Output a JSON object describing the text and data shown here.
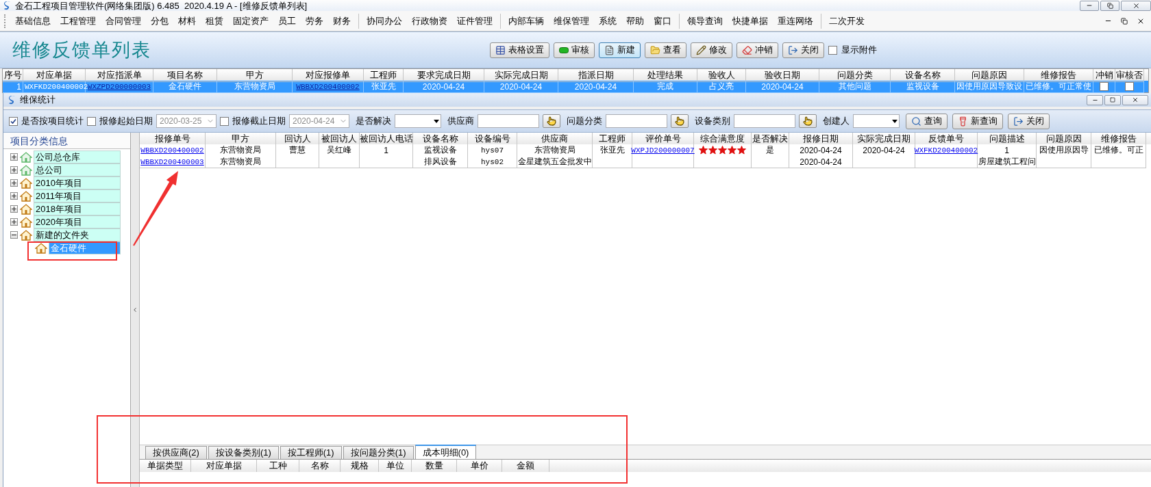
{
  "window": {
    "title": "金石工程项目管理软件(网络集团版) 6.485  2020.4.19 A - [维修反馈单列表]"
  },
  "menu_groups": [
    [
      "基础信息",
      "工程管理",
      "合同管理",
      "分包",
      "材料",
      "租赁",
      "固定资产",
      "员工",
      "劳务",
      "财务"
    ],
    [
      "协同办公",
      "行政物资",
      "证件管理"
    ],
    [
      "内部车辆",
      "维保管理",
      "系统",
      "帮助",
      "窗口"
    ],
    [
      "领导查询",
      "快捷单据",
      "重连网络"
    ],
    [
      "二次开发"
    ]
  ],
  "list_view": {
    "title": "维修反馈单列表",
    "toolbar": [
      {
        "label": "表格设置",
        "focused": false
      },
      {
        "label": "审核",
        "focused": false
      },
      {
        "label": "新建",
        "focused": true
      },
      {
        "label": "查看",
        "focused": false
      },
      {
        "label": "修改",
        "focused": false
      },
      {
        "label": "冲销",
        "focused": false
      },
      {
        "label": "关闭",
        "focused": false
      }
    ],
    "show_attachments": {
      "label": "显示附件",
      "checked": false
    },
    "table": {
      "columns": [
        {
          "label": "序号",
          "kind": "number"
        },
        {
          "label": "对应单据",
          "kind": "code"
        },
        {
          "label": "对应指派单",
          "kind": "link"
        },
        {
          "label": "项目名称",
          "kind": "text"
        },
        {
          "label": "甲方",
          "kind": "text"
        },
        {
          "label": "对应报修单",
          "kind": "link"
        },
        {
          "label": "工程师",
          "kind": "text"
        },
        {
          "label": "要求完成日期",
          "kind": "text"
        },
        {
          "label": "实际完成日期",
          "kind": "text"
        },
        {
          "label": "指派日期",
          "kind": "text"
        },
        {
          "label": "处理结果",
          "kind": "text"
        },
        {
          "label": "验收人",
          "kind": "text"
        },
        {
          "label": "验收日期",
          "kind": "text"
        },
        {
          "label": "问题分类",
          "kind": "text"
        },
        {
          "label": "设备名称",
          "kind": "text"
        },
        {
          "label": "问题原因",
          "kind": "text"
        },
        {
          "label": "维修报告",
          "kind": "text"
        },
        {
          "label": "冲销",
          "kind": "check"
        },
        {
          "label": "审核否",
          "kind": "check"
        }
      ],
      "rows": [
        {
          "selected": true,
          "cells": [
            "1",
            "WXFKD200400002",
            "WXZPD200000003",
            "金石硬件",
            "东营物资局",
            "WBBXD200400002",
            "张亚先",
            "2020-04-24",
            "2020-04-24",
            "2020-04-24",
            "完成",
            "占义亮",
            "2020-04-24",
            "其他问题",
            "监视设备",
            "因使用原因导致设",
            "已维修。可正常使",
            {
              "checked": false
            },
            {
              "checked": false
            }
          ]
        }
      ]
    }
  },
  "stats_window": {
    "title": "维保统计",
    "filters": [
      {
        "kind": "check",
        "label": "是否按项目统计",
        "checked": true
      },
      {
        "kind": "date",
        "label": "报修起始日期",
        "checked": false,
        "value": "2020-03-25"
      },
      {
        "kind": "date",
        "label": "报修截止日期",
        "checked": false,
        "value": "2020-04-24"
      },
      {
        "kind": "select",
        "label": "是否解决"
      },
      {
        "kind": "lookup",
        "label": "供应商"
      },
      {
        "kind": "lookup",
        "label": "问题分类"
      },
      {
        "kind": "lookup",
        "label": "设备类别"
      },
      {
        "kind": "select",
        "label": "创建人"
      }
    ],
    "buttons": [
      "查询",
      "新查询",
      "关闭"
    ],
    "tree": {
      "title": "项目分类信息",
      "items": [
        {
          "label": "公司总仓库",
          "kind": "company",
          "expanded": false,
          "selected": false
        },
        {
          "label": "总公司",
          "kind": "company",
          "expanded": false,
          "selected": false
        },
        {
          "label": "2010年项目",
          "kind": "project",
          "expanded": false,
          "selected": false
        },
        {
          "label": "2011年项目",
          "kind": "project",
          "expanded": false,
          "selected": false
        },
        {
          "label": "2018年项目",
          "kind": "project",
          "expanded": false,
          "selected": false
        },
        {
          "label": "2020年项目",
          "kind": "project",
          "expanded": false,
          "selected": false
        },
        {
          "label": "新建的文件夹",
          "kind": "project",
          "expanded": true,
          "selected": false,
          "children": [
            {
              "label": "金石硬件",
              "kind": "project",
              "selected": true
            }
          ]
        }
      ]
    },
    "grid": {
      "columns": [
        {
          "label": "报修单号",
          "kind": "link"
        },
        {
          "label": "甲方",
          "kind": "text"
        },
        {
          "label": "回访人",
          "kind": "text"
        },
        {
          "label": "被回访人",
          "kind": "text"
        },
        {
          "label": "被回访人电话",
          "kind": "text"
        },
        {
          "label": "设备名称",
          "kind": "text"
        },
        {
          "label": "设备编号",
          "kind": "code"
        },
        {
          "label": "供应商",
          "kind": "text"
        },
        {
          "label": "工程师",
          "kind": "text"
        },
        {
          "label": "评价单号",
          "kind": "link"
        },
        {
          "label": "综合满意度",
          "kind": "stars"
        },
        {
          "label": "是否解决",
          "kind": "text"
        },
        {
          "label": "报修日期",
          "kind": "text"
        },
        {
          "label": "实际完成日期",
          "kind": "text"
        },
        {
          "label": "反馈单号",
          "kind": "link"
        },
        {
          "label": "问题描述",
          "kind": "text"
        },
        {
          "label": "问题原因",
          "kind": "text"
        },
        {
          "label": "维修报告",
          "kind": "text"
        }
      ],
      "rows": [
        {
          "stars": 5,
          "cells": [
            "WBBXD200400002",
            "东营物资局",
            "曹慧",
            "吴红峰",
            "1",
            "监视设备",
            "hys07",
            "东营物资局",
            "张亚先",
            "WXPJD200000007",
            null,
            "是",
            "2020-04-24",
            "2020-04-24",
            "WXFKD200400002",
            "1",
            "因使用原因导",
            "已维修。可正"
          ]
        },
        {
          "cells": [
            "WBBXD200400003",
            "东营物资局",
            null,
            null,
            null,
            "排风设备",
            "hys02",
            "金星建筑五金批发中",
            null,
            null,
            null,
            null,
            "2020-04-24",
            null,
            null,
            "房屋建筑工程问",
            null,
            null
          ]
        }
      ]
    },
    "tabs": [
      {
        "label": "按供应商(2)",
        "selected": false
      },
      {
        "label": "按设备类别(1)",
        "selected": false
      },
      {
        "label": "按工程师(1)",
        "selected": false
      },
      {
        "label": "按问题分类(1)",
        "selected": false
      },
      {
        "label": "成本明细(0)",
        "selected": true
      }
    ],
    "cost_columns": [
      "单据类型",
      "对应单据",
      "工种",
      "名称",
      "规格",
      "单位",
      "数量",
      "单价",
      "金额"
    ]
  }
}
